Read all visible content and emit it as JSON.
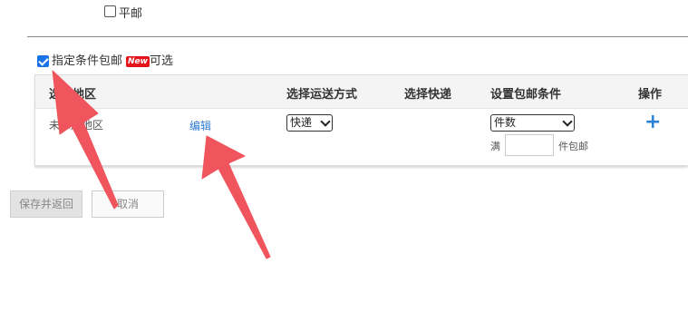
{
  "top_option": {
    "label": "平邮",
    "checked": false
  },
  "free_shipping": {
    "label": "指定条件包邮",
    "badge": "New",
    "suffix": "可选",
    "checked": true
  },
  "table": {
    "headers": {
      "region": "选择地区",
      "transport": "选择运送方式",
      "express": "选择快递",
      "condition": "设置包邮条件",
      "action": "操作"
    },
    "row": {
      "region_value": "未添加地区",
      "edit_link": "编辑",
      "transport_value": "快递",
      "condition_value": "件数",
      "full_prefix": "满",
      "full_input_value": "",
      "full_suffix": "件包邮",
      "add_symbol": "+"
    }
  },
  "buttons": {
    "save": "保存并返回",
    "cancel": "取消"
  },
  "colors": {
    "accent": "#2e7bd3",
    "arrow": "#f0545c",
    "badge": "#e4141b"
  }
}
